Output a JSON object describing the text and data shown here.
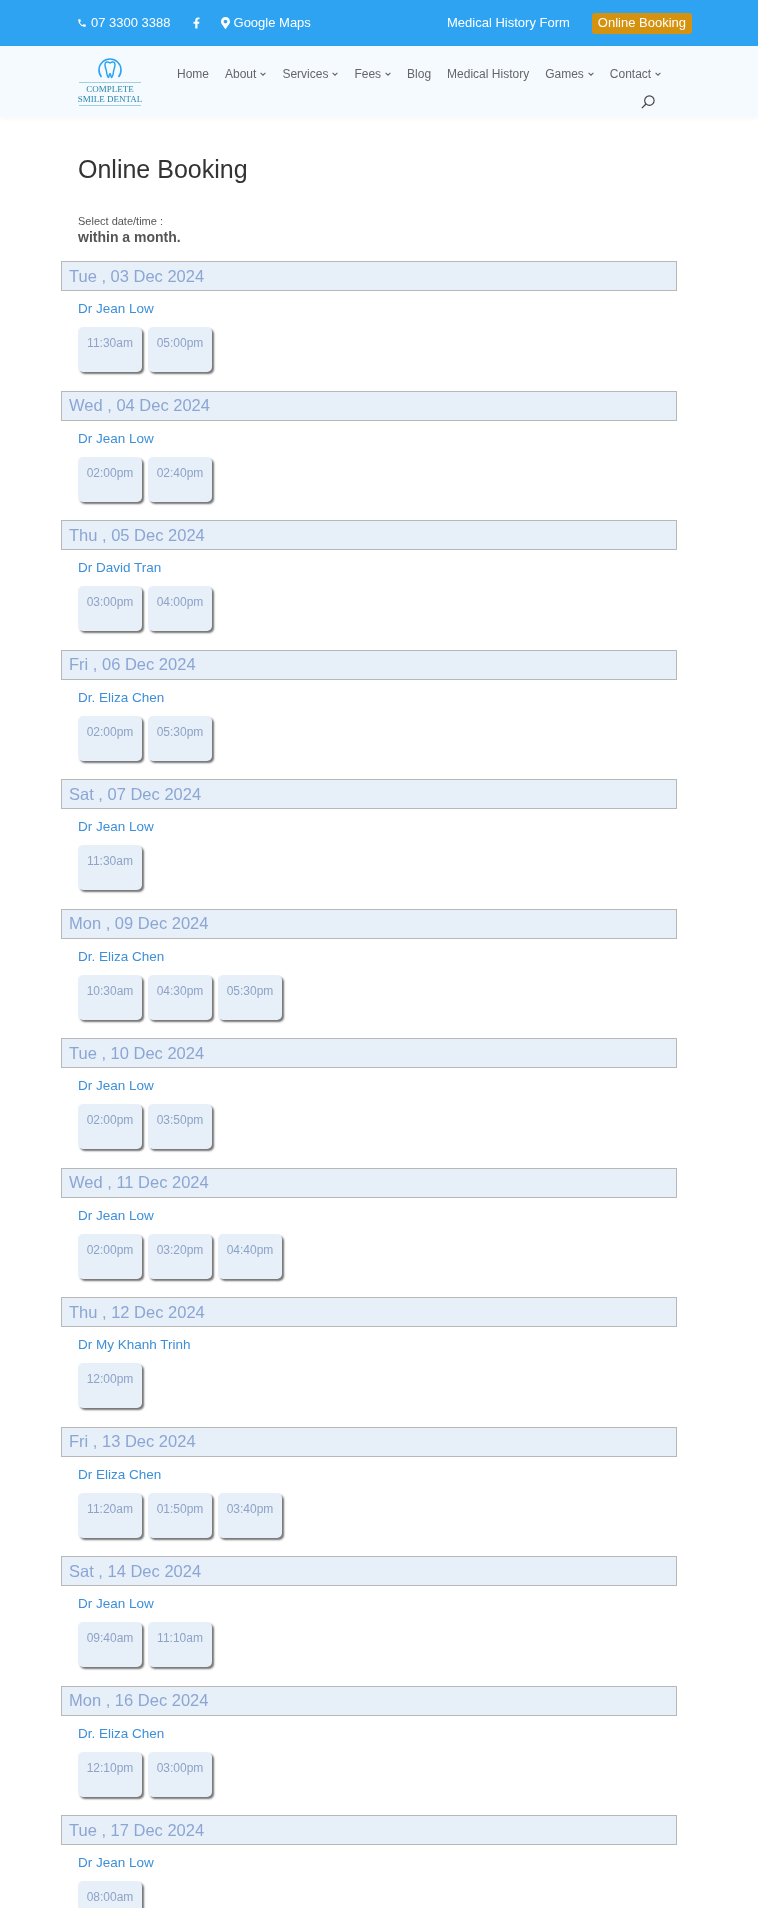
{
  "top_bar": {
    "contacts": [
      {
        "kind": "phone",
        "text": "07 3300 3388"
      },
      {
        "kind": "facebook"
      },
      {
        "kind": "map",
        "text": "Google Maps"
      }
    ],
    "links": [
      {
        "kind": "link",
        "label": "Medical History Form"
      },
      {
        "kind": "button",
        "label": "Online Booking"
      }
    ]
  },
  "header": {
    "logo": {
      "lines": [
        "COMPLETE",
        "SMILE DENTAL"
      ]
    },
    "nav": [
      {
        "label": "Home",
        "has_submenu": false
      },
      {
        "label": "About",
        "has_submenu": true
      },
      {
        "label": "Services",
        "has_submenu": true
      },
      {
        "label": "Fees",
        "has_submenu": true
      },
      {
        "label": "Blog",
        "has_submenu": false
      },
      {
        "label": "Medical History",
        "has_submenu": false
      },
      {
        "label": "Games",
        "has_submenu": true
      },
      {
        "label": "Contact",
        "has_submenu": true
      }
    ]
  },
  "page": {
    "title": "Online Booking",
    "prompt": "Select date/time :",
    "range": "within a month."
  },
  "days": [
    {
      "date": "Tue , 03 Dec 2024",
      "doctor": "Dr Jean Low",
      "times": [
        "11:30am",
        "05:00pm"
      ]
    },
    {
      "date": "Wed , 04 Dec 2024",
      "doctor": "Dr Jean Low",
      "times": [
        "02:00pm",
        "02:40pm"
      ]
    },
    {
      "date": "Thu , 05 Dec 2024",
      "doctor": "Dr David Tran",
      "times": [
        "03:00pm",
        "04:00pm"
      ]
    },
    {
      "date": "Fri , 06 Dec 2024",
      "doctor": "Dr. Eliza Chen",
      "times": [
        "02:00pm",
        "05:30pm"
      ]
    },
    {
      "date": "Sat , 07 Dec 2024",
      "doctor": "Dr Jean Low",
      "times": [
        "11:30am"
      ]
    },
    {
      "date": "Mon , 09 Dec 2024",
      "doctor": "Dr. Eliza Chen",
      "times": [
        "10:30am",
        "04:30pm",
        "05:30pm"
      ]
    },
    {
      "date": "Tue , 10 Dec 2024",
      "doctor": "Dr Jean Low",
      "times": [
        "02:00pm",
        "03:50pm"
      ]
    },
    {
      "date": "Wed , 11 Dec 2024",
      "doctor": "Dr Jean Low",
      "times": [
        "02:00pm",
        "03:20pm",
        "04:40pm"
      ]
    },
    {
      "date": "Thu , 12 Dec 2024",
      "doctor": "Dr My Khanh Trinh",
      "times": [
        "12:00pm"
      ]
    },
    {
      "date": "Fri , 13 Dec 2024",
      "doctor": "Dr Eliza Chen",
      "times": [
        "11:20am",
        "01:50pm",
        "03:40pm"
      ]
    },
    {
      "date": "Sat , 14 Dec 2024",
      "doctor": "Dr Jean Low",
      "times": [
        "09:40am",
        "11:10am"
      ]
    },
    {
      "date": "Mon , 16 Dec 2024",
      "doctor": "Dr. Eliza Chen",
      "times": [
        "12:10pm",
        "03:00pm"
      ]
    },
    {
      "date": "Tue , 17 Dec 2024",
      "doctor": "Dr Jean Low",
      "times": [
        "08:00am"
      ]
    }
  ]
}
